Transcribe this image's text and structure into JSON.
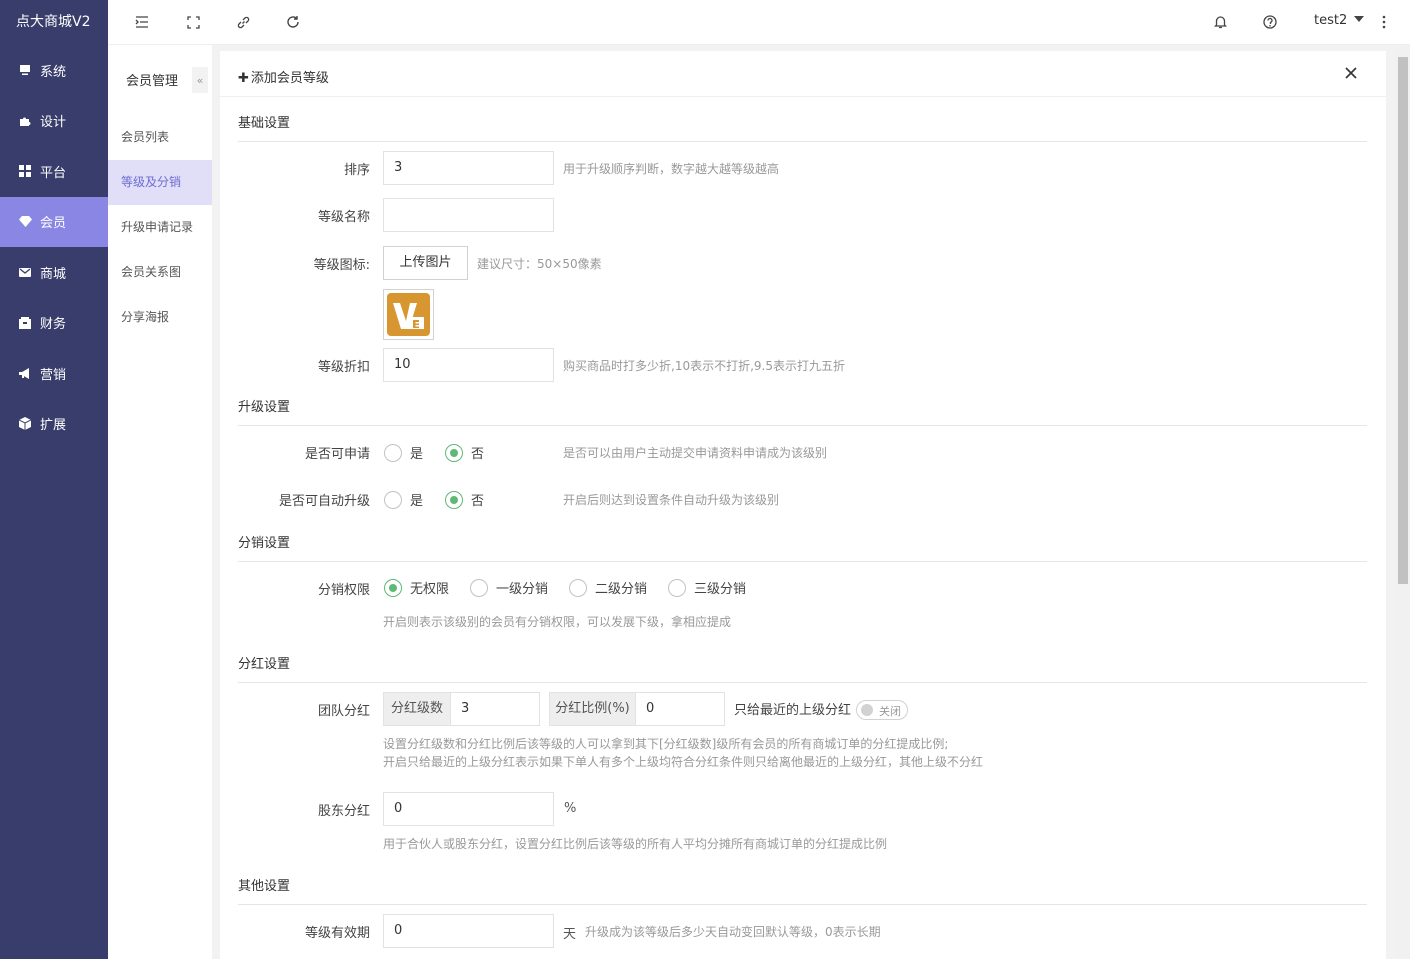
{
  "app": {
    "brand": "点大商城V2"
  },
  "sidebar": {
    "items": [
      {
        "label": "系统",
        "icon": "monitor-icon"
      },
      {
        "label": "设计",
        "icon": "puzzle-icon"
      },
      {
        "label": "平台",
        "icon": "grid-icon"
      },
      {
        "label": "会员",
        "icon": "diamond-icon"
      },
      {
        "label": "商城",
        "icon": "mail-icon"
      },
      {
        "label": "财务",
        "icon": "wallet-icon"
      },
      {
        "label": "营销",
        "icon": "megaphone-icon"
      },
      {
        "label": "扩展",
        "icon": "cube-icon"
      }
    ]
  },
  "topbar": {
    "user": "test2"
  },
  "submenu": {
    "title": "会员管理",
    "collapse": "«",
    "items": [
      "会员列表",
      "等级及分销",
      "升级申请记录",
      "会员关系图",
      "分享海报"
    ]
  },
  "panel": {
    "title": "添加会员等级",
    "basic": {
      "section": "基础设置",
      "sort_label": "排序",
      "sort_value": "3",
      "sort_tip": "用于升级顺序判断，数字越大越等级越高",
      "name_label": "等级名称",
      "name_value": "",
      "icon_label": "等级图标:",
      "upload_btn": "上传图片",
      "icon_tip": "建议尺寸：50×50像素",
      "discount_label": "等级折扣",
      "discount_value": "10",
      "discount_tip": "购买商品时打多少折,10表示不打折,9.5表示打九五折"
    },
    "upgrade": {
      "section": "升级设置",
      "apply_label": "是否可申请",
      "yes": "是",
      "no": "否",
      "apply_tip": "是否可以由用户主动提交申请资料申请成为该级别",
      "auto_label": "是否可自动升级",
      "auto_tip": "开启后则达到设置条件自动升级为该级别"
    },
    "distribution": {
      "section": "分销设置",
      "perm_label": "分销权限",
      "options": [
        "无权限",
        "一级分销",
        "二级分销",
        "三级分销"
      ],
      "selected": "无权限",
      "tip": "开启则表示该级别的会员有分销权限，可以发展下级，拿相应提成"
    },
    "bonus": {
      "section": "分红设置",
      "team_label": "团队分红",
      "levels_addon": "分红级数",
      "levels_value": "3",
      "ratio_addon": "分红比例(%)",
      "ratio_value": "0",
      "nearest_label": "只给最近的上级分红",
      "switch_text": "关闭",
      "tip1": "设置分红级数和分红比例后该等级的人可以拿到其下[分红级数]级所有会员的所有商城订单的分红提成比例;",
      "tip2": "开启只给最近的上级分红表示如果下单人有多个上级均符合分红条件则只给离他最近的上级分红，其他上级不分红",
      "share_label": "股东分红",
      "share_value": "0",
      "share_unit": "%",
      "share_tip": "用于合伙人或股东分红，设置分红比例后该等级的所有人平均分摊所有商城订单的分红提成比例"
    },
    "other": {
      "section": "其他设置",
      "valid_label": "等级有效期",
      "valid_value": "0",
      "valid_unit": "天",
      "valid_tip": "升级成为该等级后多少天自动变回默认等级，0表示长期"
    }
  },
  "colors": {
    "sidebar": "#393d6b",
    "accent": "#8a87e4",
    "radio_on": "#5fb878"
  }
}
